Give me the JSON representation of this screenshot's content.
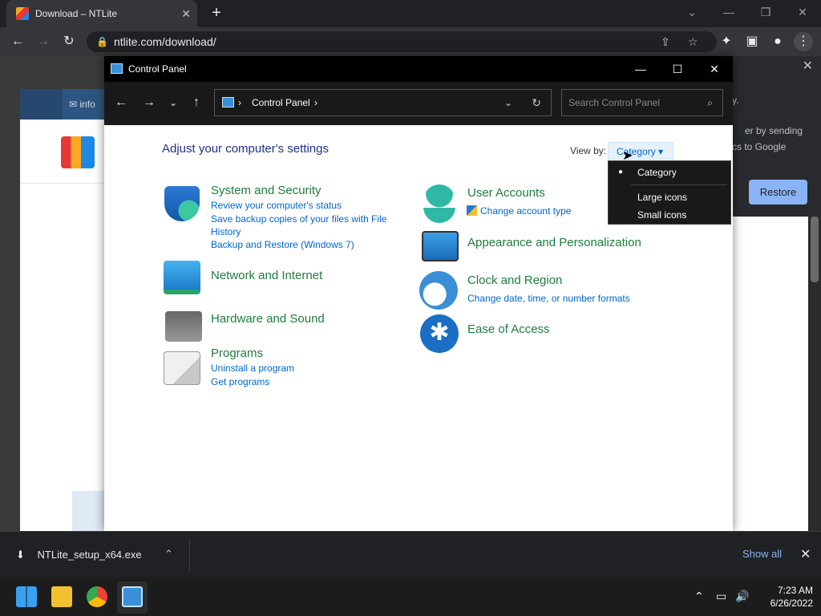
{
  "browser": {
    "tab_title": "Download – NTLite",
    "url": "ntlite.com/download/",
    "new_tab_label": "+",
    "tab_close": "✕"
  },
  "webpage": {
    "header_text": "info",
    "popup_text_1": "er by sending",
    "popup_text_2": "cs to Google",
    "popup_text_3": "y.",
    "restore_button": "Restore"
  },
  "control_panel": {
    "window_title": "Control Panel",
    "address": "Control Panel",
    "search_placeholder": "Search Control Panel",
    "heading": "Adjust your computer's settings",
    "view_by_label": "View by:",
    "view_by_value": "Category",
    "view_options": [
      "Category",
      "Large icons",
      "Small icons"
    ],
    "categories": [
      {
        "title": "System and Security",
        "links": [
          "Review your computer's status",
          "Save backup copies of your files with File History",
          "Backup and Restore (Windows 7)"
        ]
      },
      {
        "title": "Network and Internet",
        "links": []
      },
      {
        "title": "Hardware and Sound",
        "links": []
      },
      {
        "title": "Programs",
        "links": [
          "Uninstall a program",
          "Get programs"
        ]
      },
      {
        "title": "User Accounts",
        "links": [
          "Change account type"
        ]
      },
      {
        "title": "Appearance and Personalization",
        "links": []
      },
      {
        "title": "Clock and Region",
        "links": [
          "Change date, time, or number formats"
        ]
      },
      {
        "title": "Ease of Access",
        "links": []
      }
    ]
  },
  "download_bar": {
    "file_name": "NTLite_setup_x64.exe",
    "show_all": "Show all"
  },
  "taskbar": {
    "time": "7:23 AM",
    "date": "6/26/2022"
  },
  "colors": {
    "category_green": "#1e7d3e",
    "link_blue": "#0066cc",
    "heading_blue": "#1e3287",
    "chrome_link": "#8ab4f8"
  }
}
